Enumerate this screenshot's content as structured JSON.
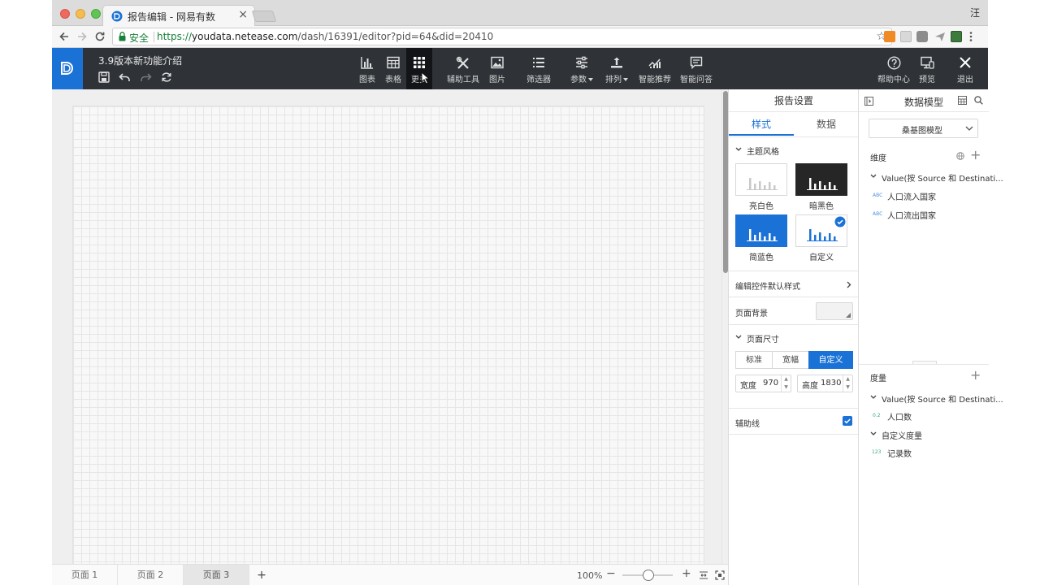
{
  "browser": {
    "tab_title": "报告编辑 - 网易有数",
    "tab_close": "×",
    "user_initial": "汪",
    "secure_label": "安全",
    "url_scheme": "https://",
    "url_domain": "youdata.netease.com",
    "url_path": "/dash/16391/editor?pid=64&did=20410"
  },
  "app": {
    "document_title": "3.9版本新功能介绍",
    "toolbar": [
      {
        "label": "图表",
        "icon": "bar-chart-icon"
      },
      {
        "label": "表格",
        "icon": "table-icon"
      },
      {
        "label": "更多",
        "icon": "grid-icon"
      },
      {
        "label": "辅助工具",
        "icon": "tools-icon"
      },
      {
        "label": "图片",
        "icon": "image-icon"
      },
      {
        "label": "筛选器",
        "icon": "list-icon"
      },
      {
        "label": "参数",
        "icon": "sliders-icon"
      },
      {
        "label": "排列",
        "icon": "align-icon"
      },
      {
        "label": "智能推荐",
        "icon": "smart-chart-icon"
      },
      {
        "label": "智能问答",
        "icon": "chat-icon"
      }
    ],
    "right_tools": [
      {
        "label": "帮助中心",
        "icon": "help-icon"
      },
      {
        "label": "预览",
        "icon": "preview-icon"
      },
      {
        "label": "退出",
        "icon": "close-icon"
      }
    ]
  },
  "pages": {
    "tabs": [
      "页面 1",
      "页面 2",
      "页面 3"
    ],
    "active": "页面 3",
    "add": "+",
    "zoom": "100%"
  },
  "settings": {
    "header": "报告设置",
    "tabs": [
      "样式",
      "数据"
    ],
    "theme_section": "主题风格",
    "themes": [
      {
        "name": "亮白色",
        "selected": false
      },
      {
        "name": "暗黑色",
        "selected": false
      },
      {
        "name": "简蓝色",
        "selected": false
      },
      {
        "name": "自定义",
        "selected": true
      }
    ],
    "edit_default_style": "编辑控件默认样式",
    "page_background": "页面背景",
    "page_size_section": "页面尺寸",
    "size_options": [
      "标准",
      "宽幅",
      "自定义"
    ],
    "size_selected": "自定义",
    "width_label": "宽度",
    "width_value": "970",
    "height_label": "高度",
    "height_value": "1830",
    "guide_lines": "辅助线",
    "guide_lines_checked": true
  },
  "model": {
    "header": "数据模型",
    "selected_model": "桑基图模型",
    "dimensions_label": "维度",
    "dimension_group": "Value(按 Source 和 Destinati...",
    "dimensions": [
      {
        "type": "ABC",
        "name": "人口流入国家"
      },
      {
        "type": "ABC",
        "name": "人口流出国家"
      }
    ],
    "measures_label": "度量",
    "measure_group": "Value(按 Source 和 Destinati...",
    "measures": [
      {
        "type": "0.2",
        "name": "人口数"
      }
    ],
    "custom_measure_group": "自定义度量",
    "custom_measures": [
      {
        "type": "123",
        "name": "记录数"
      }
    ]
  },
  "colors": {
    "accent": "#1b72d6",
    "header_bg": "#2f3338",
    "secure_green": "#188038"
  }
}
